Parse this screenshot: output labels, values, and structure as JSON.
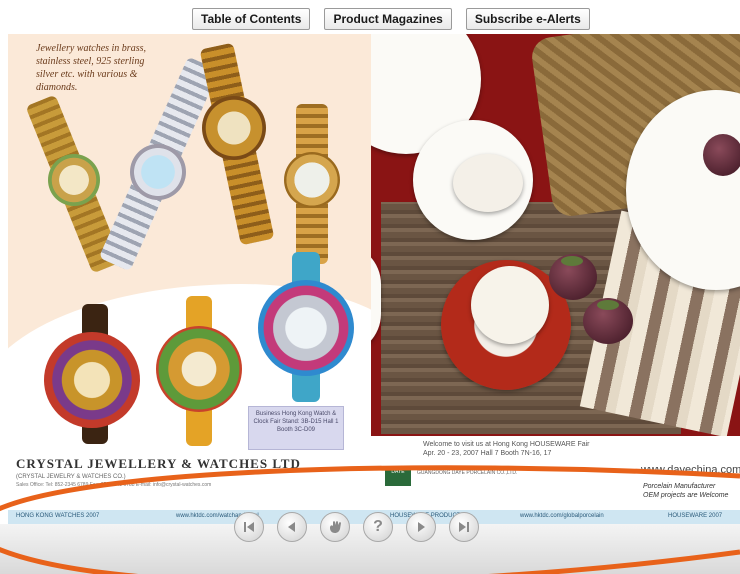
{
  "tabs": [
    {
      "label": "Table of Contents"
    },
    {
      "label": "Product Magazines"
    },
    {
      "label": "Subscribe e-Alerts"
    }
  ],
  "left_page": {
    "ad_copy": "Jewellery watches in brass, stainless steel, 925 sterling silver etc. with various & diamonds.",
    "info_box": "Business Hong Kong Watch & Clock Fair Stand: 3B-D15 Hall 1 Booth 3C-D09",
    "brand_name": "CRYSTAL JEWELLERY & WATCHES LTD",
    "brand_sub": "(CRYSTAL JEWELRY & WATCHES CO.)",
    "brand_small": "Sales Office: Tel: 852-2345 6789  Fax: 852-2345 6788  E-mail: info@crystal-watches.com",
    "footer_left": "HONG KONG WATCHES 2007",
    "footer_mid": "www.hktdc.com/watchandjewel"
  },
  "right_page": {
    "visit_text": "Welcome to visit us at Hong Kong HOUSEWARE Fair",
    "visit_text2": "Apr. 20 - 23, 2007 Hall 7 Booth 7N-16, 17",
    "logo_text": "DAYE",
    "company": "GUANGDONG DAYE PORCELAIN CO.,LTD.",
    "url": "www.dayechina.com",
    "tag1": "Porcelain Manufacturer",
    "tag2": "OEM projects are Welcome",
    "footer_left": "HOUSEWARE PRODUCTS",
    "footer_mid": "www.hktdc.com/globalporcelain",
    "footer_right": "HOUSEWARE 2007"
  },
  "nav": {
    "first_icon": "first-page-icon",
    "prev_icon": "previous-page-icon",
    "fit_icon": "hand-icon",
    "help_label": "?",
    "next_icon": "next-page-icon",
    "last_icon": "last-page-icon"
  },
  "colors": {
    "annotation_ring": "#e8621a",
    "tablecloth": "#8a1414",
    "footer_strip": "#cfe6f2"
  }
}
